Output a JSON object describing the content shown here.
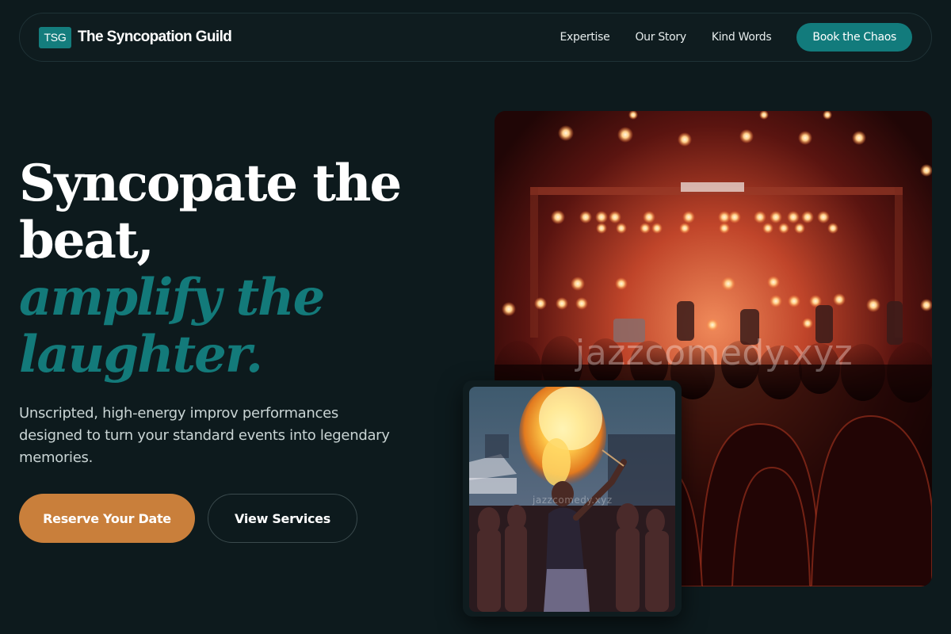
{
  "nav": {
    "logo_badge": "TSG",
    "brand_name": "The Syncopation Guild",
    "links": [
      "Expertise",
      "Our Story",
      "Kind Words"
    ],
    "cta_label": "Book the Chaos"
  },
  "hero": {
    "headline_line1": "Syncopate the beat,",
    "headline_accent": "amplify the laughter.",
    "subtext": "Unscripted, high-energy improv performances designed to turn your standard events into legendary memories.",
    "primary_button": "Reserve Your Date",
    "secondary_button": "View Services"
  },
  "images": {
    "main_watermark": "jazzcomedy.xyz",
    "fire_watermark": "jazzcomedy.xyz"
  },
  "colors": {
    "background": "#0d1a1d",
    "accent_teal": "#137a7a",
    "button_orange": "#c97f3b"
  }
}
